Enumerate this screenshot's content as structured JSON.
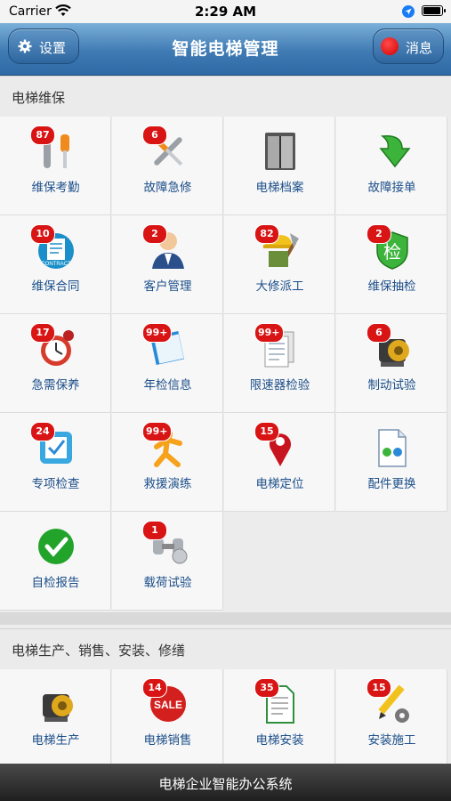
{
  "status": {
    "carrier": "Carrier",
    "time": "2:29 AM"
  },
  "nav": {
    "title": "智能电梯管理",
    "settings_label": "设置",
    "messages_label": "消息"
  },
  "section1": {
    "title": "电梯维保",
    "items": [
      {
        "label": "维保考勤",
        "badge": "87",
        "icon": "tools-icon"
      },
      {
        "label": "故障急修",
        "badge": "6",
        "icon": "wrench-screwdriver-icon"
      },
      {
        "label": "电梯档案",
        "badge": "",
        "icon": "elevator-icon"
      },
      {
        "label": "故障接单",
        "badge": "",
        "icon": "green-arrow-down-icon"
      },
      {
        "label": "维保合同",
        "badge": "10",
        "icon": "contract-icon"
      },
      {
        "label": "客户管理",
        "badge": "2",
        "icon": "customer-icon"
      },
      {
        "label": "大修派工",
        "badge": "82",
        "icon": "worker-shovel-icon"
      },
      {
        "label": "维保抽检",
        "badge": "2",
        "icon": "inspection-shield-icon"
      },
      {
        "label": "急需保养",
        "badge": "17",
        "icon": "alarm-clock-icon"
      },
      {
        "label": "年检信息",
        "badge": "99+",
        "icon": "notebook-icon"
      },
      {
        "label": "限速器检验",
        "badge": "99+",
        "icon": "documents-icon"
      },
      {
        "label": "制动试验",
        "badge": "6",
        "icon": "motor-icon"
      },
      {
        "label": "专项检查",
        "badge": "24",
        "icon": "checklist-icon"
      },
      {
        "label": "救援演练",
        "badge": "99+",
        "icon": "running-man-icon"
      },
      {
        "label": "电梯定位",
        "badge": "15",
        "icon": "map-pin-icon"
      },
      {
        "label": "配件更换",
        "badge": "",
        "icon": "file-swap-icon"
      },
      {
        "label": "自检报告",
        "badge": "",
        "icon": "green-check-icon"
      },
      {
        "label": "载荷试验",
        "badge": "1",
        "icon": "weights-icon"
      }
    ]
  },
  "section2": {
    "title": "电梯生产、销售、安装、修缮",
    "items": [
      {
        "label": "电梯生产",
        "badge": "",
        "icon": "motor-icon"
      },
      {
        "label": "电梯销售",
        "badge": "14",
        "icon": "sale-tag-icon"
      },
      {
        "label": "电梯安装",
        "badge": "35",
        "icon": "document-icon"
      },
      {
        "label": "安装施工",
        "badge": "15",
        "icon": "pencil-gear-icon"
      }
    ]
  },
  "footer": {
    "text": "电梯企业智能办公系统"
  },
  "colors": {
    "nav_blue": "#3f7ab3",
    "badge_red": "#d81414",
    "label_blue": "#1c4f8a"
  }
}
